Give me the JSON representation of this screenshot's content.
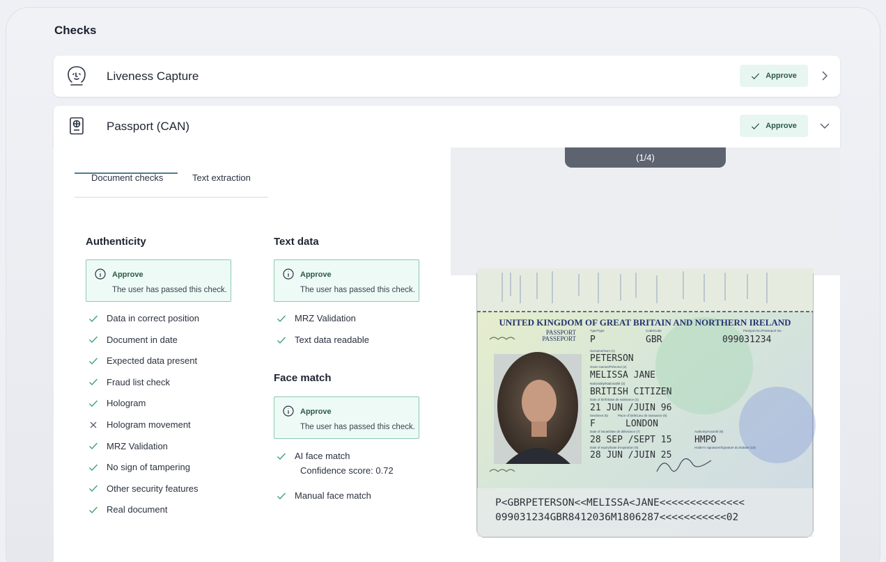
{
  "page": {
    "title": "Checks"
  },
  "rows": [
    {
      "label": "Liveness Capture",
      "icon": "face-icon",
      "approve_label": "Approve",
      "chevron": "chevron-right-icon"
    },
    {
      "label": "Passport (CAN)",
      "icon": "passport-icon",
      "approve_label": "Approve",
      "chevron": "chevron-down-icon"
    }
  ],
  "tabs": [
    {
      "label": "Document checks",
      "active": true
    },
    {
      "label": "Text extraction",
      "active": false
    }
  ],
  "authenticity": {
    "heading": "Authenticity",
    "box": {
      "title": "Approve",
      "description": "The user has passed this check."
    },
    "items": [
      {
        "label": "Data in correct position",
        "status": "pass"
      },
      {
        "label": "Document in date",
        "status": "pass"
      },
      {
        "label": "Expected data present",
        "status": "pass"
      },
      {
        "label": "Fraud list check",
        "status": "pass"
      },
      {
        "label": "Hologram",
        "status": "pass"
      },
      {
        "label": "Hologram movement",
        "status": "fail"
      },
      {
        "label": "MRZ Validation",
        "status": "pass"
      },
      {
        "label": "No sign of tampering",
        "status": "pass"
      },
      {
        "label": "Other security features",
        "status": "pass"
      },
      {
        "label": "Real document",
        "status": "pass"
      }
    ]
  },
  "text_data": {
    "heading": "Text data",
    "box": {
      "title": "Approve",
      "description": "The user has passed this check."
    },
    "items": [
      {
        "label": "MRZ Validation",
        "status": "pass"
      },
      {
        "label": "Text data readable",
        "status": "pass"
      }
    ]
  },
  "face_match": {
    "heading": "Face match",
    "box": {
      "title": "Approve",
      "description": "The user has passed this check."
    },
    "items": [
      {
        "label": "AI face match",
        "sub": "Confidence score: 0.72",
        "status": "pass"
      },
      {
        "label": "Manual face match",
        "status": "pass"
      }
    ]
  },
  "viewer": {
    "pager": "(1/4)",
    "passport": {
      "country_header": "UNITED KINGDOM OF GREAT BRITAIN AND NORTHERN IRELAND",
      "doc_label_1": "PASSPORT",
      "doc_label_2": "PASSEPORT",
      "type_caption": "Type/Type",
      "type": "P",
      "code_caption": "Code/Code",
      "code": "GBR",
      "number_caption": "Passport No./Passeport No.",
      "number": "099031234",
      "surname_caption": "Surname/Nom (1)",
      "surname": "PETERSON",
      "given_caption": "Given names/Prénoms (2)",
      "given_names": "MELISSA JANE",
      "nationality_caption": "Nationality/Nationalité (3)",
      "nationality": "BRITISH CITIZEN",
      "dob_caption": "Date of birth/Date de naissance (4)",
      "dob": "21 JUN /JUIN 96",
      "sex_caption": "Sex/Sexe (5)",
      "place_caption": "Place of birth/Lieu de naissance (6)",
      "sex": "F",
      "place_of_birth": "LONDON",
      "issue_caption": "Date of issue/Date de délivrance (7)",
      "issue_date": "28 SEP /SEPT 15",
      "authority_caption": "Authority/Autorité (8)",
      "authority": "HMPO",
      "signature_caption": "Holder's signature/Signature du titulaire (10)",
      "expiry_caption": "Date of expiry/Date d'expiration (9)",
      "expiry_date": "28 JUN /JUIN 25",
      "mrz_line1": "P<GBRPETERSON<<MELISSA<JANE<<<<<<<<<<<<<<",
      "mrz_line2": "099031234GBR8412036M1806287<<<<<<<<<<<02"
    }
  },
  "colors": {
    "approve_bg": "#e7f6f0",
    "approve_border": "#8cc9b1",
    "check_green": "#3fa07a",
    "fail_grey": "#5b6270",
    "tab_underline": "#4b7c99",
    "pager_bg": "#5d6470"
  }
}
